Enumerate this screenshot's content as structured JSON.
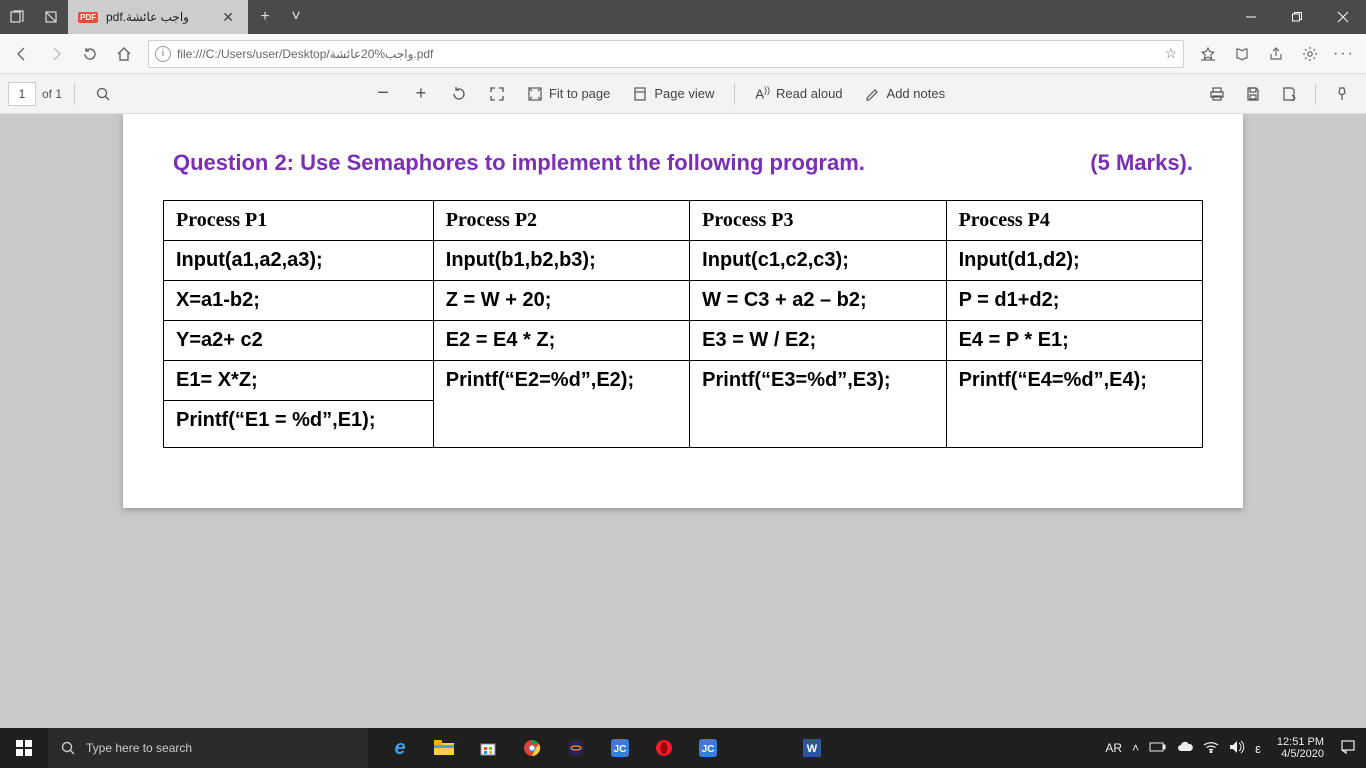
{
  "titlebar": {
    "tab_label": "pdf.واجب عائشة",
    "new_tab_icon": "plus-icon",
    "tabs_chevron_icon": "chevron-down-icon"
  },
  "addressbar": {
    "url": "file:///C:/Users/user/Desktop/واجب%20عائشة.pdf"
  },
  "pdftoolbar": {
    "page_current": "1",
    "page_of_label": "of 1",
    "fit_label": "Fit to page",
    "pageview_label": "Page view",
    "readaloud_label": "Read aloud",
    "addnotes_label": "Add notes"
  },
  "document": {
    "question_title": "Question 2: Use Semaphores to implement the following program.",
    "marks": "(5 Marks).",
    "headers": [
      "Process P1",
      "Process P2",
      "Process P3",
      "Process P4"
    ],
    "rows": [
      [
        "Input(a1,a2,a3);",
        "Input(b1,b2,b3);",
        "Input(c1,c2,c3);",
        "Input(d1,d2);"
      ],
      [
        "X=a1-b2;",
        "Z = W + 20;",
        "W = C3 + a2 – b2;",
        "P = d1+d2;"
      ],
      [
        "Y=a2+ c2",
        "E2 = E4 * Z;",
        "E3 = W / E2;",
        "E4 = P * E1;"
      ],
      [
        "E1= X*Z;",
        "Printf(“E2=%d”,E2);",
        "Printf(“E3=%d”,E3);",
        "Printf(“E4=%d”,E4);"
      ],
      [
        "Printf(“E1 = %d”,E1);",
        "",
        "",
        ""
      ]
    ]
  },
  "taskbar": {
    "search_placeholder": "Type here to search",
    "lang": "AR",
    "ime": "ε",
    "time": "12:51 PM",
    "date": "4/5/2020"
  }
}
